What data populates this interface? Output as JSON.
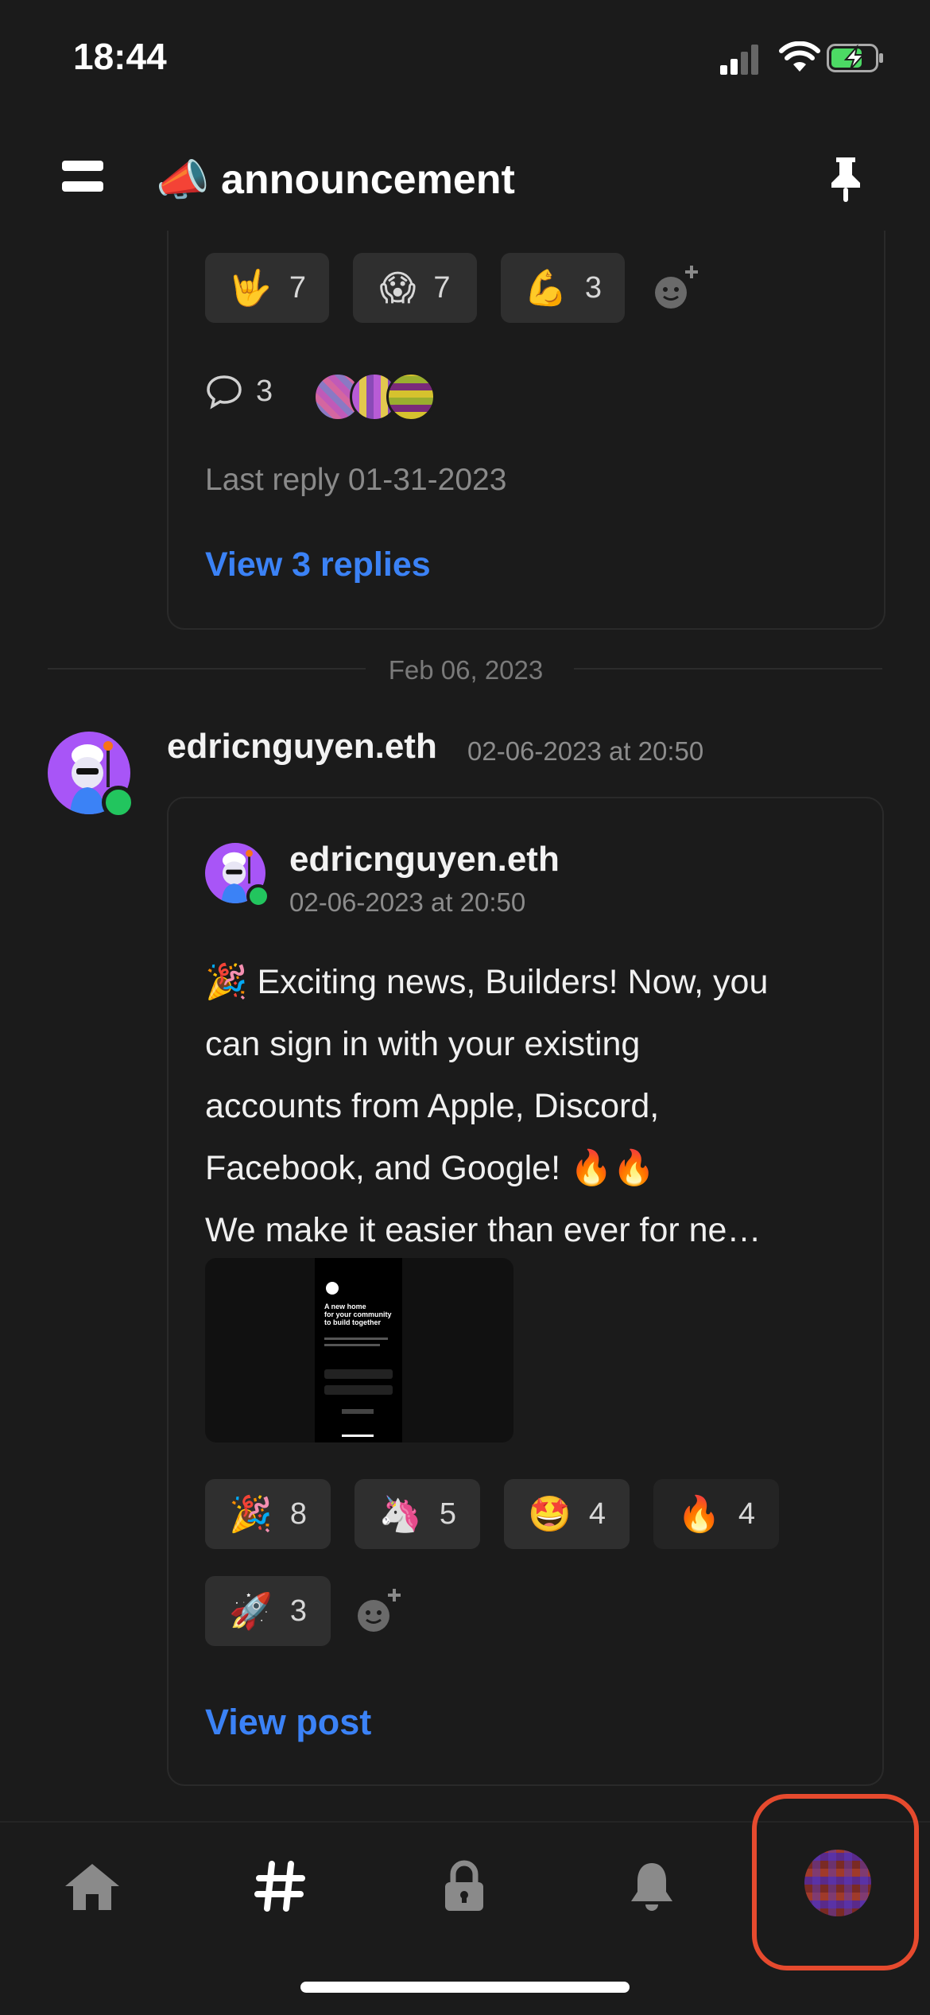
{
  "status_bar": {
    "time": "18:44"
  },
  "header": {
    "channel_emoji": "📣",
    "channel_name": "announcement"
  },
  "previous_post": {
    "reactions": [
      {
        "emoji": "🤟",
        "count": "7"
      },
      {
        "emoji": "😱",
        "count": "7"
      },
      {
        "emoji": "💪",
        "count": "3"
      }
    ],
    "reply_count": "3",
    "last_reply": "Last reply 01-31-2023",
    "view_replies": "View 3 replies"
  },
  "date_divider": "Feb 06, 2023",
  "post": {
    "username": "edricnguyen.eth",
    "timestamp": "02-06-2023 at 20:50",
    "inner_username": "edricnguyen.eth",
    "inner_timestamp": "02-06-2023 at 20:50",
    "body": "🎉 Exciting news, Builders! Now, you\ncan sign in with your existing\naccounts from Apple, Discord,\nFacebook, and Google! 🔥🔥\nWe make it easier than ever for ne…",
    "preview": {
      "heading": "A new home\nfor your community\nto build together"
    },
    "reactions": [
      {
        "emoji": "🎉",
        "count": "8"
      },
      {
        "emoji": "🦄",
        "count": "5"
      },
      {
        "emoji": "🤩",
        "count": "4"
      },
      {
        "emoji": "🔥",
        "count": "4"
      },
      {
        "emoji": "🚀",
        "count": "3"
      }
    ],
    "view_post": "View post"
  },
  "tab_bar": {
    "items": [
      "home-icon",
      "hashtag-icon",
      "lock-icon",
      "bell-icon",
      "profile-avatar"
    ],
    "highlight_color": "#e64a2e"
  },
  "colors": {
    "link": "#3b82f6",
    "online": "#22c55e",
    "background": "#1b1b1b"
  }
}
